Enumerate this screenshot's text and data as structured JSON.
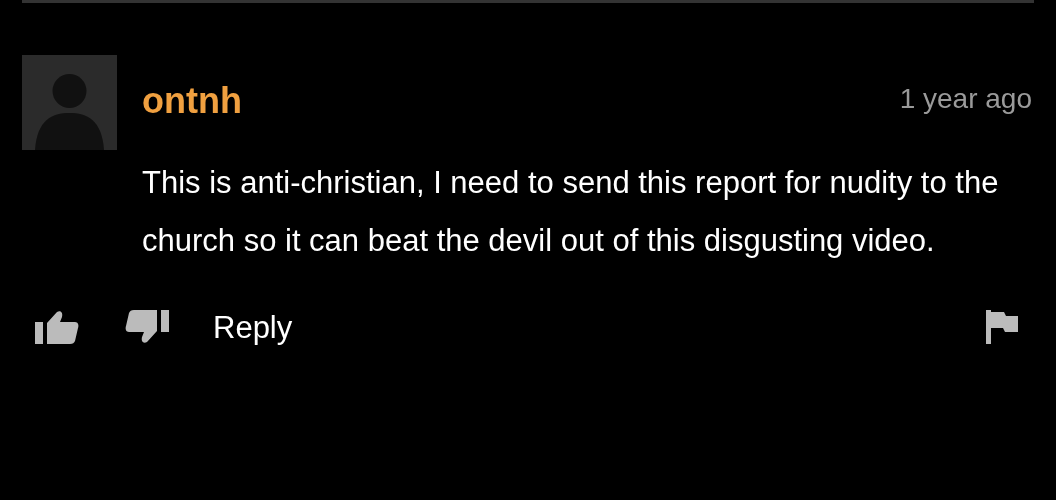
{
  "comment": {
    "username": "ontnh",
    "time": "1 year ago",
    "text": "This is anti-christian, I need to send this report for nudity to the church so it can beat the devil out of this disgusting video.",
    "actions": {
      "reply": "Reply"
    }
  }
}
